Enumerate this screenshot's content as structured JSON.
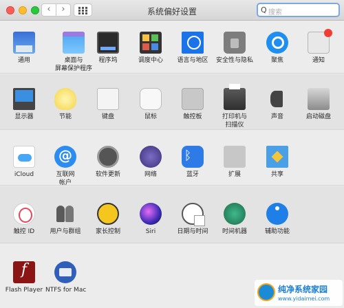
{
  "window": {
    "title": "系统偏好设置"
  },
  "toolbar": {
    "back_glyph": "‹",
    "forward_glyph": "›",
    "search_placeholder": "搜索",
    "search_icon": "search-icon"
  },
  "rows": [
    {
      "items": [
        {
          "label": "通用",
          "icon": "general-icon"
        },
        {
          "label": "桌面与\n屏幕保护程序",
          "icon": "desktop-screensaver-icon"
        },
        {
          "label": "程序坞",
          "icon": "dock-icon"
        },
        {
          "label": "调度中心",
          "icon": "mission-control-icon"
        },
        {
          "label": "语言与地区",
          "icon": "language-region-icon"
        },
        {
          "label": "安全性与隐私",
          "icon": "security-privacy-icon"
        },
        {
          "label": "聚焦",
          "icon": "spotlight-icon"
        },
        {
          "label": "通知",
          "icon": "notifications-icon"
        }
      ]
    },
    {
      "items": [
        {
          "label": "显示器",
          "icon": "displays-icon"
        },
        {
          "label": "节能",
          "icon": "energy-saver-icon"
        },
        {
          "label": "键盘",
          "icon": "keyboard-icon"
        },
        {
          "label": "鼠标",
          "icon": "mouse-icon"
        },
        {
          "label": "触控板",
          "icon": "trackpad-icon"
        },
        {
          "label": "打印机与\n扫描仪",
          "icon": "printer-scanner-icon"
        },
        {
          "label": "声音",
          "icon": "sound-icon"
        },
        {
          "label": "启动磁盘",
          "icon": "startup-disk-icon"
        }
      ]
    },
    {
      "items": [
        {
          "label": "iCloud",
          "icon": "icloud-icon"
        },
        {
          "label": "互联网\n帐户",
          "icon": "internet-accounts-icon"
        },
        {
          "label": "软件更新",
          "icon": "software-update-icon"
        },
        {
          "label": "网络",
          "icon": "network-icon"
        },
        {
          "label": "蓝牙",
          "icon": "bluetooth-icon"
        },
        {
          "label": "扩展",
          "icon": "extensions-icon"
        },
        {
          "label": "共享",
          "icon": "sharing-icon"
        }
      ]
    },
    {
      "items": [
        {
          "label": "触控 ID",
          "icon": "touch-id-icon"
        },
        {
          "label": "用户与群组",
          "icon": "users-groups-icon"
        },
        {
          "label": "家长控制",
          "icon": "parental-controls-icon"
        },
        {
          "label": "Siri",
          "icon": "siri-icon"
        },
        {
          "label": "日期与时间",
          "icon": "date-time-icon"
        },
        {
          "label": "时间机器",
          "icon": "time-machine-icon"
        },
        {
          "label": "辅助功能",
          "icon": "accessibility-icon"
        }
      ]
    },
    {
      "items": [
        {
          "label": "Flash Player",
          "icon": "flash-player-icon"
        },
        {
          "label": "NTFS for Mac",
          "icon": "ntfs-for-mac-icon"
        }
      ]
    }
  ],
  "watermark": {
    "title": "纯净系统家园",
    "url": "www.yidaimei.com"
  }
}
